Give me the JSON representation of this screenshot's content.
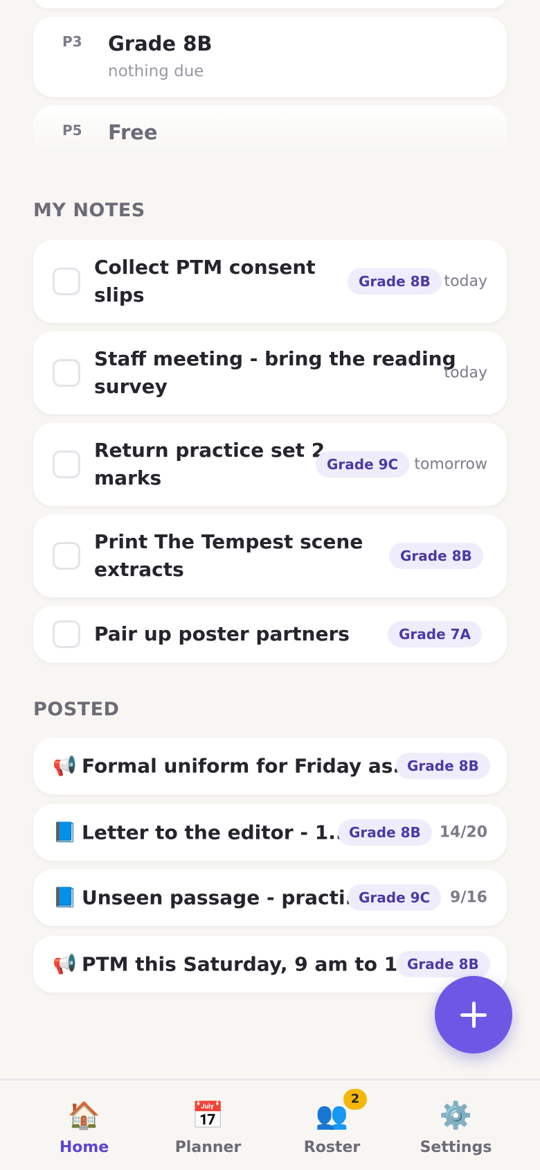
{
  "periods": [
    {
      "code": "P3",
      "title": "Grade 8B",
      "sub": "nothing due"
    },
    {
      "code": "P5",
      "title": "Free"
    }
  ],
  "notes_section": {
    "label": "MY NOTES",
    "items": [
      {
        "text_line1": "Collect PTM consent",
        "text_line2": "slips",
        "chip": "Grade 8B",
        "when": "today"
      },
      {
        "text_line1": "Staff meeting - bring the reading",
        "text_line2": "survey",
        "when": "today"
      },
      {
        "text_line1": "Return practice set 2",
        "text_line2": "marks",
        "chip": "Grade 9C",
        "when": "tomorrow"
      },
      {
        "text_line1": "Print The Tempest scene",
        "text_line2": "extracts",
        "chip": "Grade 8B"
      },
      {
        "text_line1": "Pair up poster partners",
        "chip": "Grade 7A"
      }
    ]
  },
  "posted_section": {
    "label": "POSTED",
    "items": [
      {
        "icon": "📢",
        "icon_name": "megaphone-icon",
        "text": "Formal uniform for Friday as...",
        "chip": "Grade 8B"
      },
      {
        "icon": "📘",
        "icon_name": "blue-book-icon",
        "text": "Letter to the editor - 1...",
        "chip": "Grade 8B",
        "count": "14/20"
      },
      {
        "icon": "📘",
        "icon_name": "blue-book-icon",
        "text": "Unseen passage - practi...",
        "chip": "Grade 9C",
        "count": "9/16"
      },
      {
        "icon": "📢",
        "icon_name": "megaphone-icon",
        "text": "PTM this Saturday, 9 am to 1...",
        "chip": "Grade 8B"
      }
    ]
  },
  "fab": {
    "icon": "plus-icon"
  },
  "tabs": [
    {
      "icon": "🏠",
      "icon_name": "house-icon",
      "label": "Home",
      "active": true
    },
    {
      "icon": "📅",
      "icon_name": "calendar-icon",
      "label": "Planner"
    },
    {
      "icon": "👥",
      "icon_name": "people-icon",
      "label": "Roster",
      "badge": "2"
    },
    {
      "icon": "⚙️",
      "icon_name": "gear-icon",
      "label": "Settings"
    }
  ],
  "colors": {
    "accent": "#6f57e6",
    "chip_bg": "#efedfb",
    "chip_text": "#4a3aa8",
    "badge": "#f5b70a",
    "background": "#f7f6f2"
  }
}
